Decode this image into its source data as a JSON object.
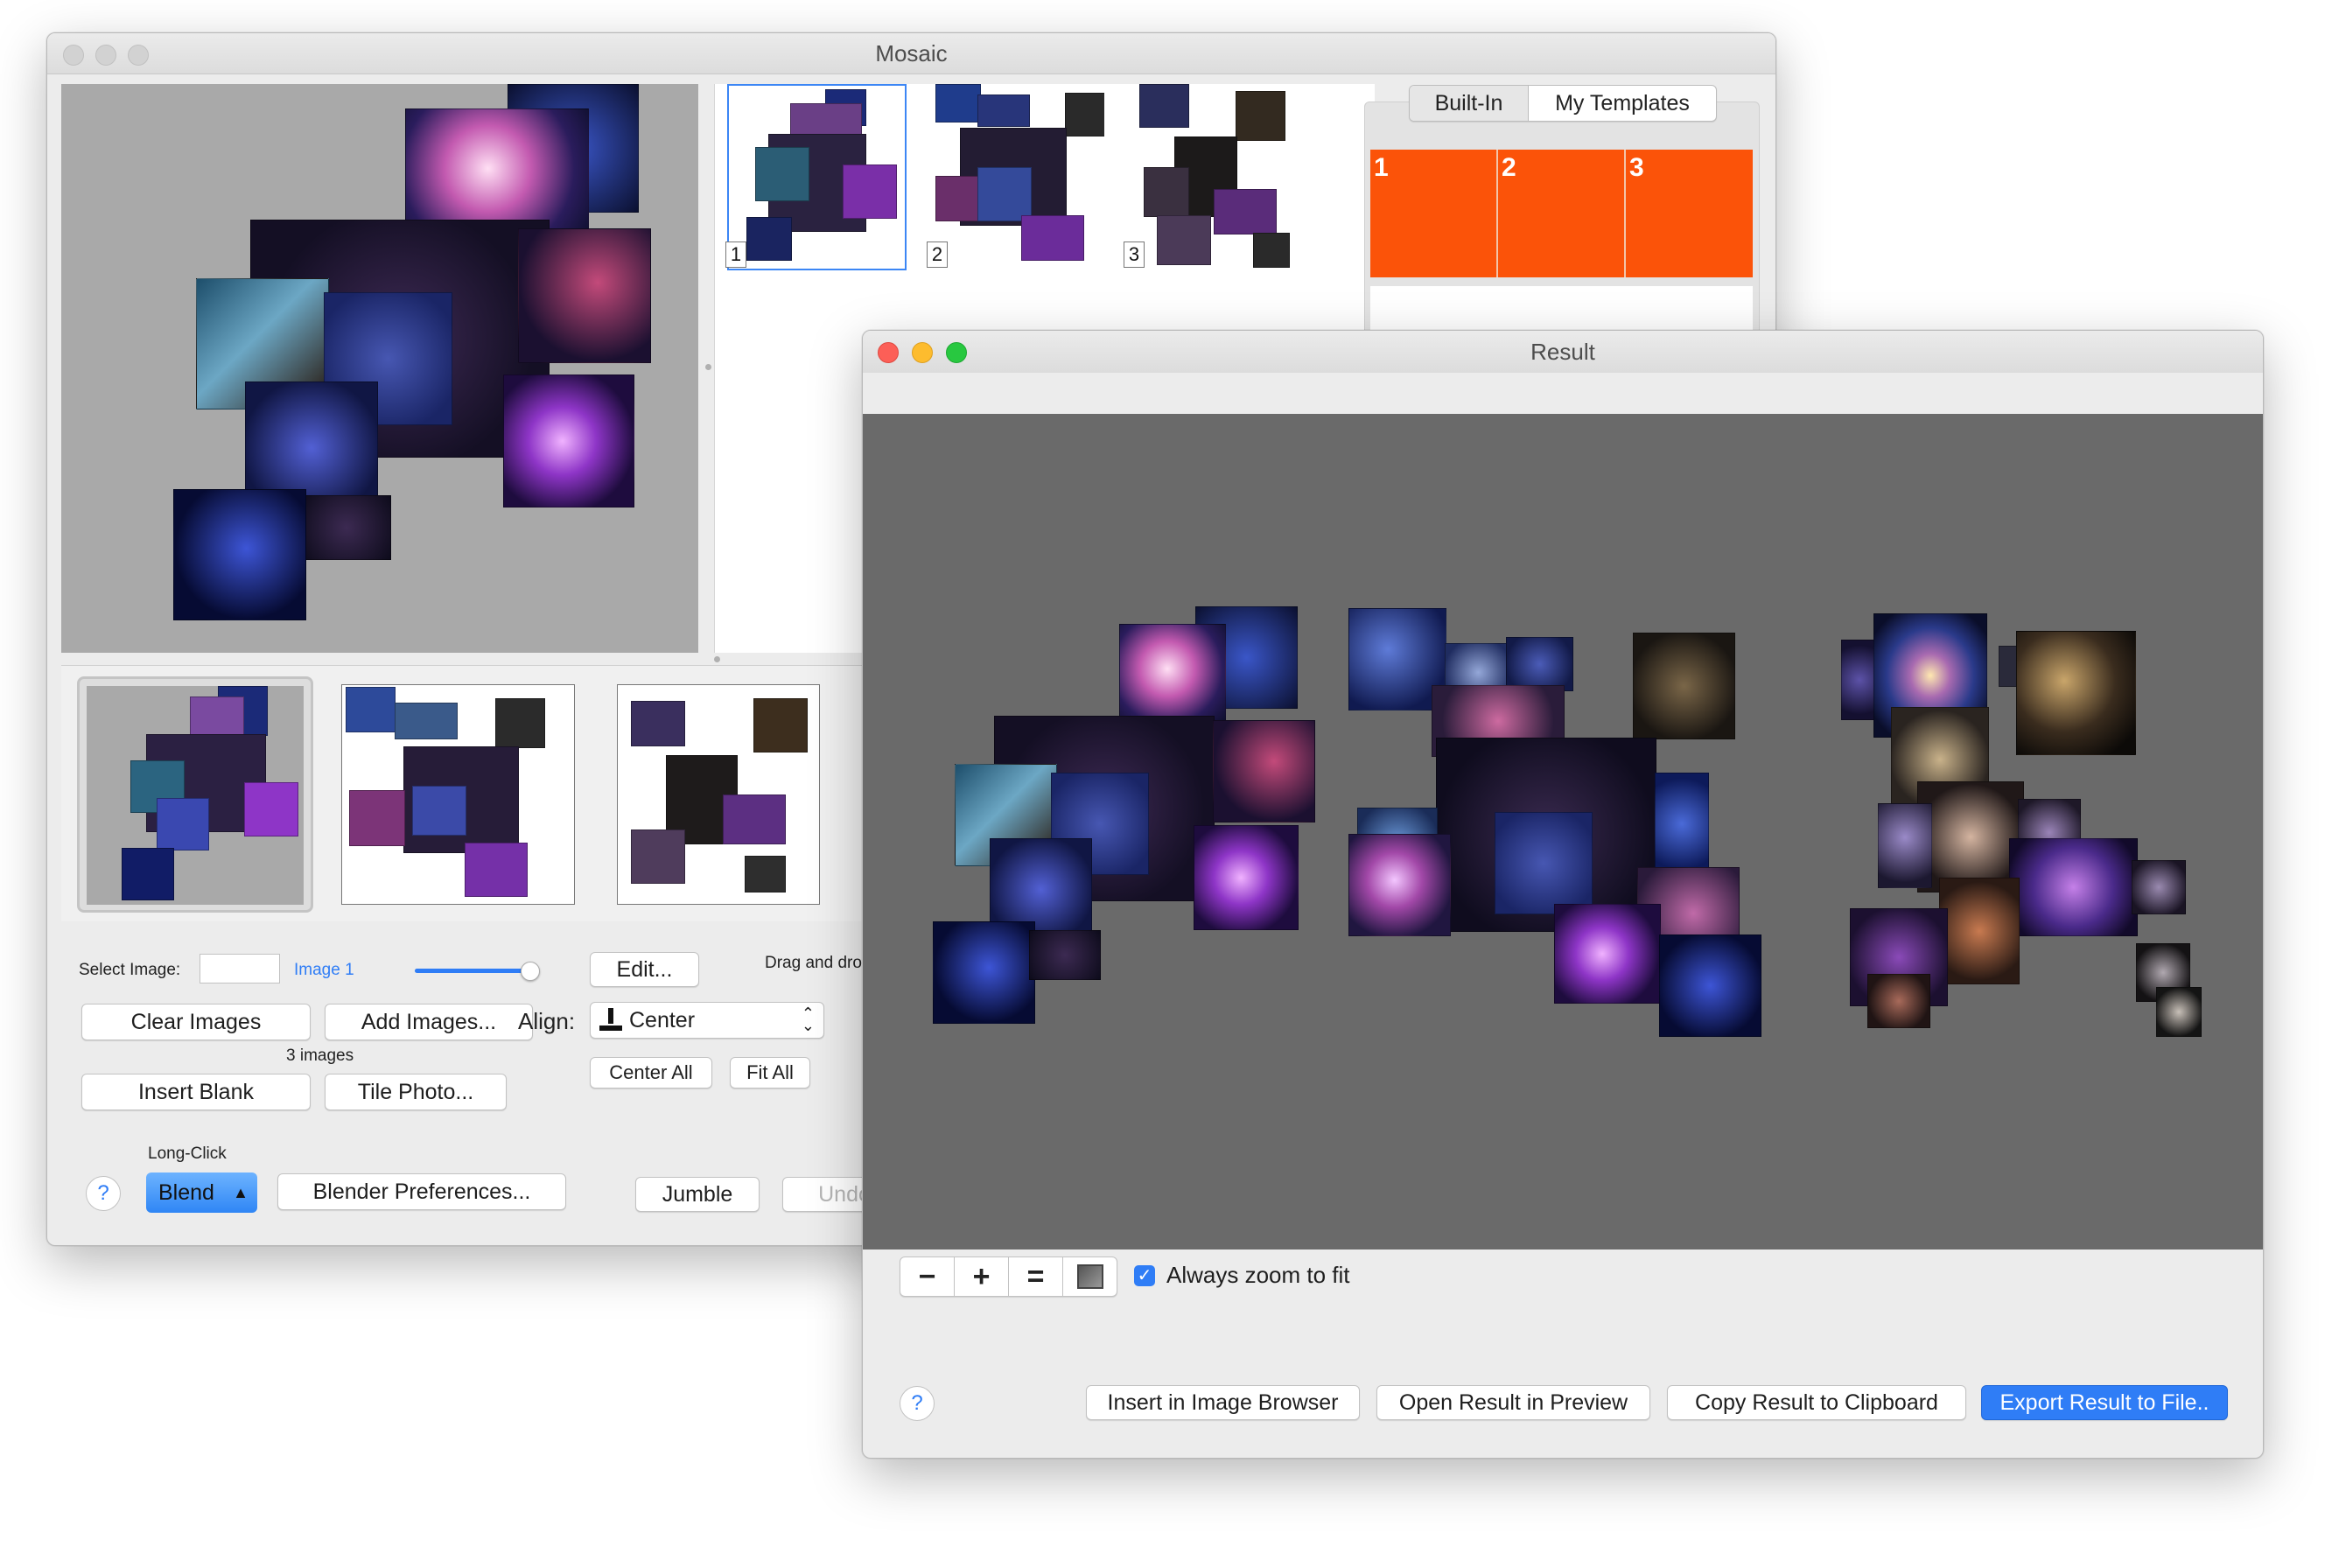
{
  "mosaic_window": {
    "title": "Mosaic",
    "template_tabs": [
      "Built-In",
      "My Templates"
    ],
    "templates": [
      "1",
      "2",
      "3"
    ],
    "layout_numbers": [
      "1",
      "2",
      "3"
    ],
    "select_image_label": "Select Image:",
    "image_link": "Image 1",
    "slider_value": 0.92,
    "edit_label": "Edit...",
    "drag_drop_label": "Drag and dro",
    "clear_images_label": "Clear Images",
    "add_images_label": "Add Images...",
    "image_count": "3 images",
    "align_label": "Align:",
    "align_value": "Center",
    "center_all_label": "Center All",
    "fit_all_label": "Fit All",
    "insert_blank_label": "Insert Blank",
    "tile_photo_label": "Tile Photo...",
    "long_click_label": "Long-Click",
    "help_label": "?",
    "blend_label": "Blend",
    "blend_arrow": "▲",
    "blender_prefs_label": "Blender Preferences...",
    "jumble_label": "Jumble",
    "undo_label": "Undo"
  },
  "result_window": {
    "title": "Result",
    "zoom_out": "−",
    "zoom_in": "+",
    "zoom_actual": "=",
    "always_zoom_label": "Always zoom to fit",
    "always_zoom_checked": true,
    "help_label": "?",
    "insert_browser_label": "Insert in Image Browser",
    "open_preview_label": "Open Result in Preview",
    "copy_clipboard_label": "Copy Result to Clipboard",
    "export_label": "Export Result to File.."
  },
  "colors": {
    "accent": "#2f7df6",
    "template_orange": "#fb5309",
    "result_canvas": "#6a6a6a",
    "preview_canvas": "#a9a9a9",
    "close": "#fc5f57",
    "minimize": "#fdbc2e",
    "zoom": "#28c840"
  }
}
